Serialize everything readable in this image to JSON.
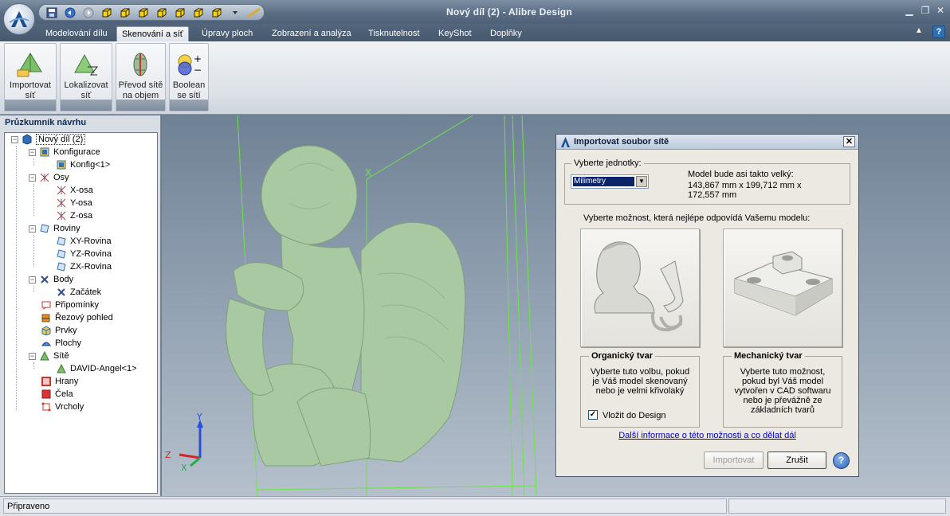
{
  "window": {
    "title": "Nový díl (2) - Alibre Design"
  },
  "tabs": [
    {
      "label": "Modelování dílu",
      "active": false
    },
    {
      "label": "Skenování a síť",
      "active": true
    },
    {
      "label": "Úpravy ploch",
      "active": false
    },
    {
      "label": "Zobrazení a analýza",
      "active": false
    },
    {
      "label": "Tisknutelnost",
      "active": false
    },
    {
      "label": "KeyShot",
      "active": false
    },
    {
      "label": "Doplňky",
      "active": false
    }
  ],
  "ribbon": {
    "buttons": [
      {
        "line1": "Importovat",
        "line2": "síť"
      },
      {
        "line1": "Lokalizovat",
        "line2": "síť"
      },
      {
        "line1": "Převod sítě",
        "line2": "na objem"
      },
      {
        "line1": "Boolean",
        "line2": "se sítí"
      }
    ]
  },
  "panel": {
    "title": "Průzkumník návrhu",
    "tree": {
      "root": "Nový díl (2)",
      "konfigurace": "Konfigurace",
      "konfig1": "Konfig<1>",
      "osy": "Osy",
      "x_osa": "X-osa",
      "y_osa": "Y-osa",
      "z_osa": "Z-osa",
      "roviny": "Roviny",
      "xy": "XY-Rovina",
      "yz": "YZ-Rovina",
      "zx": "ZX-Rovina",
      "body": "Body",
      "zacatek": "Začátek",
      "pripominky": "Připomínky",
      "rezovy": "Řezový pohled",
      "prvky": "Prvky",
      "plochy": "Plochy",
      "site": "Sítě",
      "david": "DAVID-Angel<1>",
      "hrany": "Hrany",
      "cela": "Čela",
      "vrcholy": "Vrcholy"
    }
  },
  "viewport": {
    "axis_x": "X",
    "axis_y": "Y",
    "axis_z": "Z",
    "triad_x": "Z",
    "triad_y": "Y",
    "triad_z": "X"
  },
  "dialog": {
    "title": "Importovat soubor sítě",
    "units_legend": "Vyberte jednotky:",
    "units_value": "Milimetry",
    "size_line1": "Model bude asi takto velký:",
    "size_line2": "143,867 mm x 199,712 mm x",
    "size_line3": "172,557 mm",
    "choose_text": "Vyberte možnost, která nejlépe odpovídá Vašemu modelu:",
    "organic": {
      "title": "Organický tvar",
      "line1": "Vyberte tuto volbu, pokud",
      "line2": "je Váš model skenovaný",
      "line3": "nebo je velmi křivolaký",
      "checkbox_label": "Vložit do Design",
      "checked": true
    },
    "mechanical": {
      "title": "Mechanický tvar",
      "line1": "Vyberte tuto možnost,",
      "line2": "pokud byl Váš model",
      "line3": "vytvořen v CAD softwaru",
      "line4": "nebo je převážně ze",
      "line5": "základních tvarů"
    },
    "more_info": "Další informace o této možnosti a co dělat dál",
    "btn_import": "Importovat",
    "btn_cancel": "Zrušit",
    "btn_help": "?"
  },
  "status": {
    "text": "Připraveno"
  },
  "colors": {
    "mesh": "#a9c9a2",
    "viewport_top": "#6f8194",
    "viewport_bottom": "#b5c0cc",
    "sketch_lines": "#6fe24a"
  }
}
